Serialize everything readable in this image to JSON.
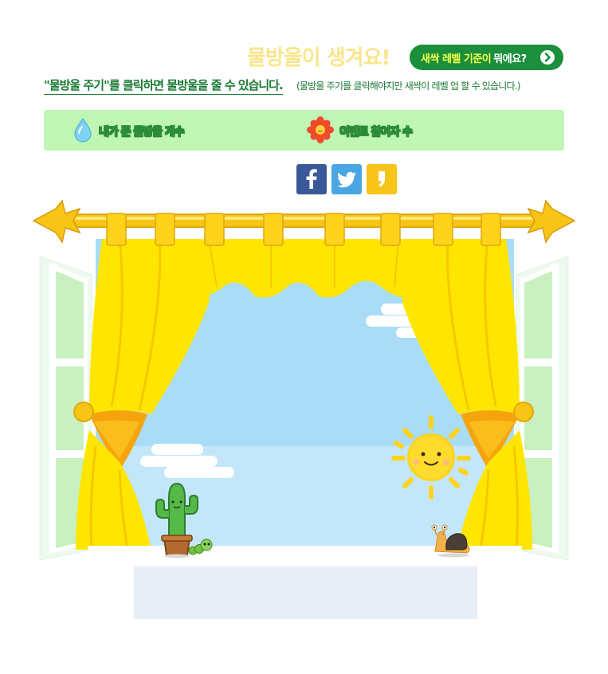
{
  "header": {
    "title": "물방울이 생겨요!",
    "level_question_highlight": "새싹 레벨 기준이",
    "level_question_rest": "뭐에요?"
  },
  "instructions": {
    "main": "\"물방울 주기\"를 클릭하면 물방울을 줄 수 있습니다.",
    "note": "(물방울 주기를 클릭해야지만 새싹이 레벨 업 할 수 있습니다.)"
  },
  "stats": {
    "drops_label": "내가 준 물방울 개수",
    "participants_label": "이벤트 참여자 수"
  },
  "social": {
    "facebook_color": "#3b5998",
    "twitter_color": "#49a6e3",
    "kakao_color": "#f7c51a"
  },
  "colors": {
    "accent_green": "#1b8f3c",
    "title_yellow": "#f9e58a",
    "stats_bg": "#bff5b5",
    "curtain_yellow": "#ffe600",
    "sky_blue": "#a9dcf6"
  }
}
